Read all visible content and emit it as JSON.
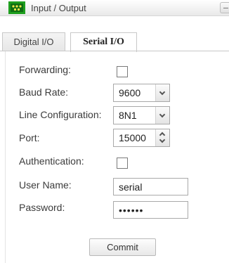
{
  "header": {
    "title": "Input / Output",
    "icon": "io-connector-icon",
    "collapse_icon": "collapse-icon"
  },
  "tabs": [
    {
      "label": "Digital I/O",
      "active": false
    },
    {
      "label": "Serial I/O",
      "active": true
    }
  ],
  "form": {
    "forwarding": {
      "label": "Forwarding:",
      "checked": false
    },
    "baud_rate": {
      "label": "Baud Rate:",
      "value": "9600"
    },
    "line_configuration": {
      "label": "Line Configuration:",
      "value": "8N1"
    },
    "port": {
      "label": "Port:",
      "value": "15000"
    },
    "authentication": {
      "label": "Authentication:",
      "checked": false
    },
    "user_name": {
      "label": "User Name:",
      "value": "serial"
    },
    "password": {
      "label": "Password:",
      "value": "serial"
    }
  },
  "commit_label": "Commit",
  "colors": {
    "icon_green": "#1e9e1e",
    "tab_border": "#c8c8c8",
    "input_border": "#a9a9a9"
  }
}
